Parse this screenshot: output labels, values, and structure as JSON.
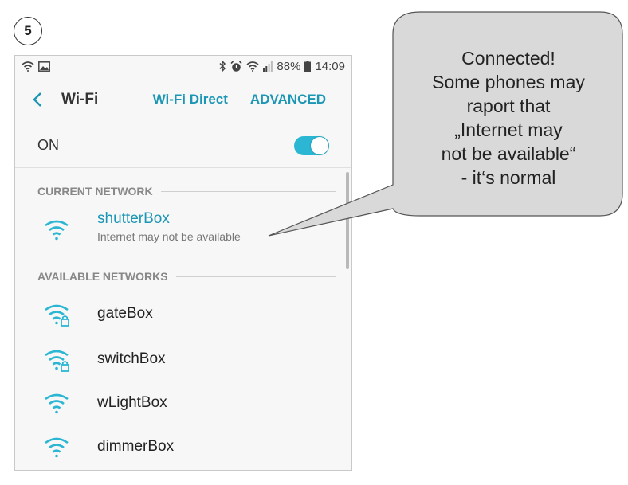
{
  "step": {
    "number": "5"
  },
  "statusbar": {
    "battery": "88%",
    "time": "14:09"
  },
  "appbar": {
    "title": "Wi-Fi",
    "wifi_direct_label": "Wi-Fi Direct",
    "advanced_label": "ADVANCED"
  },
  "wifi_toggle": {
    "label": "ON",
    "state": true
  },
  "current_network": {
    "header": "CURRENT NETWORK",
    "name": "shutterBox",
    "status": "Internet may not be available"
  },
  "available_networks": {
    "header": "AVAILABLE NETWORKS",
    "items": [
      {
        "name": "gateBox",
        "locked": true
      },
      {
        "name": "switchBox",
        "locked": true
      },
      {
        "name": "wLightBox",
        "locked": false
      },
      {
        "name": "dimmerBox",
        "locked": false
      }
    ]
  },
  "callout": {
    "lines": [
      "Connected!",
      "Some phones may",
      "raport that",
      "„Internet may",
      "not be available“",
      "- it‘s normal"
    ]
  },
  "colors": {
    "accent": "#1b96b5",
    "toggle": "#2bb7d4",
    "callout_fill": "#d9d9d9"
  }
}
